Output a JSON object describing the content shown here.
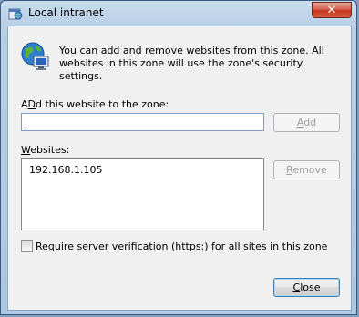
{
  "window": {
    "title": "Local intranet",
    "close_glyph": "✕",
    "app_icon": "internet-options-icon",
    "zone_icon": "globe-computer-icon"
  },
  "description": "You can add and remove websites from this zone. All websites in this zone will use the zone's security settings.",
  "add_section": {
    "label_accel": "D",
    "label_rest_before": "A",
    "label_rest_after": "d this website to the zone:",
    "input_value": "",
    "add_button_accel": "A",
    "add_button_rest": "dd"
  },
  "websites": {
    "label_accel": "W",
    "label_rest": "ebsites:",
    "items": [
      "192.168.1.105"
    ],
    "remove_button_accel": "R",
    "remove_button_rest": "emove"
  },
  "verification": {
    "checked": false,
    "label_before": "Require ",
    "label_accel": "s",
    "label_after": "erver verification (https:) for all sites in this zone"
  },
  "footer": {
    "close_accel": "C",
    "close_rest": "lose"
  }
}
